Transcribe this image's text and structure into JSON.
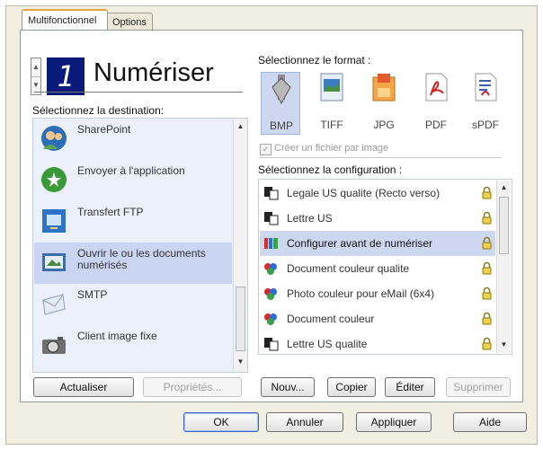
{
  "tabs": [
    {
      "label": "Multifonctionnel",
      "active": true
    },
    {
      "label": "Options",
      "active": false
    }
  ],
  "header": {
    "spinner_up": "▲",
    "spinner_down": "▼",
    "lcd_digit": "1",
    "title": "Numériser"
  },
  "destination": {
    "label": "Sélectionnez la destination:",
    "items": [
      {
        "label": "SharePoint",
        "icon": "sharepoint-icon"
      },
      {
        "label": "Envoyer à l'application",
        "icon": "send-to-application-icon"
      },
      {
        "label": "Transfert FTP",
        "icon": "ftp-transfer-icon"
      },
      {
        "label": "Ouvrir le ou les documents numérisés",
        "icon": "open-scanned-documents-icon",
        "selected": true
      },
      {
        "label": "SMTP",
        "icon": "smtp-mail-icon"
      },
      {
        "label": "Client image fixe",
        "icon": "still-image-camera-icon"
      }
    ],
    "buttons": {
      "refresh": "Actualiser",
      "properties": "Propriétés..."
    }
  },
  "format": {
    "label": "Sélectionnez le format :",
    "items": [
      {
        "label": "BMP",
        "icon": "bmp-file-icon",
        "selected": true
      },
      {
        "label": "TIFF",
        "icon": "tiff-file-icon"
      },
      {
        "label": "JPG",
        "icon": "jpg-file-icon"
      },
      {
        "label": "PDF",
        "icon": "pdf-file-icon"
      },
      {
        "label": "sPDF",
        "icon": "searchable-pdf-icon"
      }
    ],
    "checkbox_label": "Créer un fichier par image",
    "checkbox_mark": "✓"
  },
  "configuration": {
    "label": "Sélectionnez la configuration :",
    "items": [
      {
        "label": "Legale US qualite (Recto verso)",
        "icon": "bw-document-icon"
      },
      {
        "label": "Lettre US",
        "icon": "bw-document-icon"
      },
      {
        "label": "Configurer avant de numériser",
        "icon": "configure-before-scan-icon",
        "selected": true
      },
      {
        "label": "Document couleur qualite",
        "icon": "color-document-icon"
      },
      {
        "label": "Photo couleur pour eMail (6x4)",
        "icon": "color-document-icon"
      },
      {
        "label": "Document couleur",
        "icon": "color-document-icon"
      },
      {
        "label": "Lettre US qualite",
        "icon": "bw-document-icon"
      }
    ],
    "buttons": {
      "new": "Nouv...",
      "copy": "Copier",
      "edit": "Éditer",
      "delete": "Supprimer"
    }
  },
  "footer": {
    "ok": "OK",
    "cancel": "Annuler",
    "apply": "Appliquer",
    "help": "Aide"
  },
  "colors": {
    "accent_selected": "#cdd8f0",
    "lcd_bg": "#0a1a7a",
    "tab_highlight": "#e7a43f"
  }
}
